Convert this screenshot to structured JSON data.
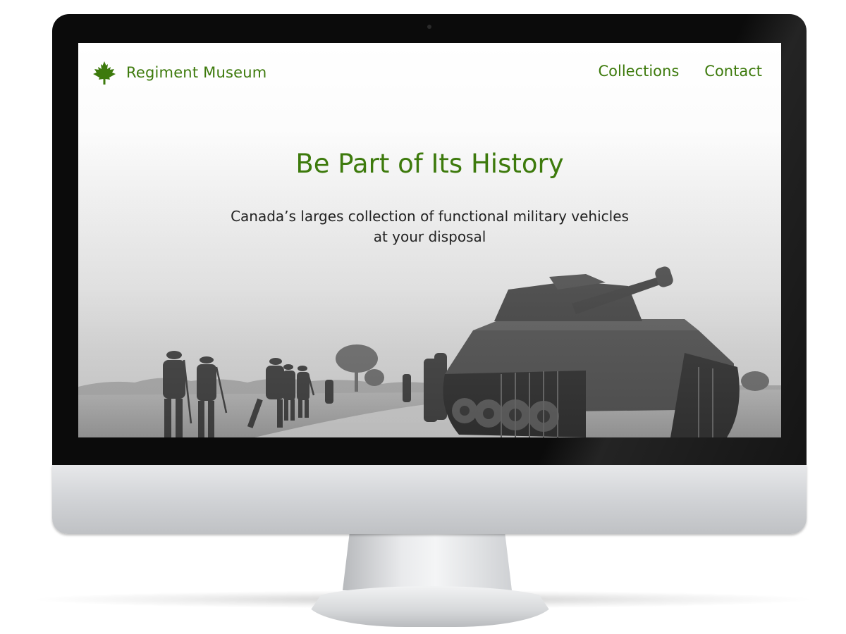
{
  "site": {
    "logo": {
      "icon": "maple-leaf-icon",
      "name": "Regiment Museum"
    },
    "nav": {
      "items": [
        {
          "label": "Collections"
        },
        {
          "label": "Contact"
        }
      ]
    },
    "hero": {
      "title": "Be Part of Its History",
      "subtitle_line1": "Canada’s larges collection of functional military vehicles",
      "subtitle_line2": "at your disposal",
      "background": "black-and-white-photo-soldiers-and-tank"
    }
  },
  "colors": {
    "accent": "#3d7a0c",
    "text": "#222222",
    "bezel": "#0b0b0b"
  }
}
